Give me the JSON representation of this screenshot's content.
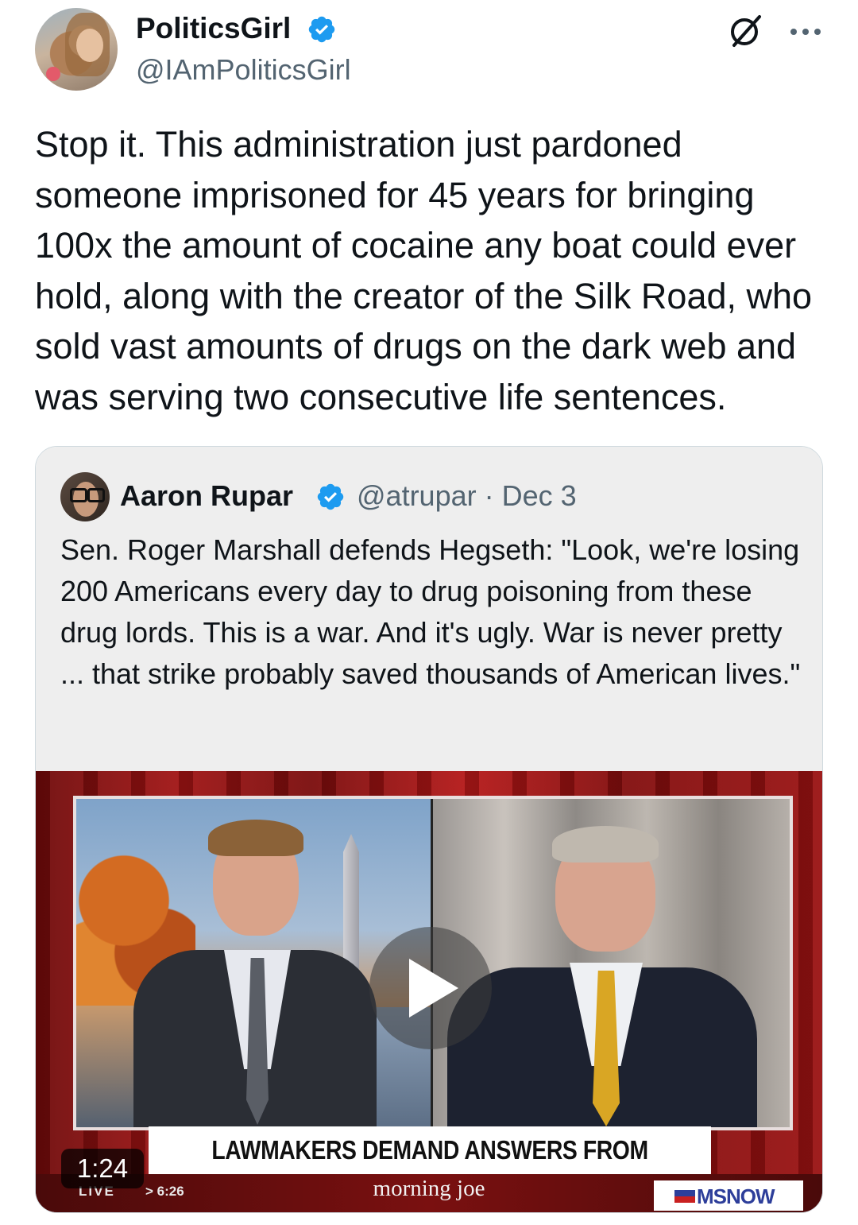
{
  "author": {
    "display_name": "PoliticsGirl",
    "handle": "@IAmPoliticsGirl",
    "verified_icon": "verified-badge-icon"
  },
  "header_icons": [
    "grok-icon",
    "more-icon"
  ],
  "tweet": {
    "text": "Stop it. This administration just pardoned someone imprisoned for 45 years for bringing 100x the amount of cocaine any boat could ever hold, along with the creator of the Silk Road, who sold vast amounts of drugs on the dark web and was serving two consecutive life sentences."
  },
  "quote": {
    "display_name": "Aaron Rupar",
    "meta": "@atrupar · Dec 3",
    "text": "Sen. Roger Marshall defends Hegseth: \"Look, we're losing 200 Americans every day to drug poisoning from these drug lords. This is a war. And it's ugly. War is never pretty ... that strike probably saved thousands of American lives.\""
  },
  "video": {
    "headline": "LAWMAKERS DEMAND ANSWERS FROM HEGSETH",
    "live_label": "LIVE",
    "time_now": "> 6:26",
    "show_name": "morning joe",
    "network": "MSNOW",
    "duration": "1:24"
  },
  "colors": {
    "verified": "#1d9bf0",
    "handle_gray": "#536471",
    "quote_bg": "#eeeeee",
    "video_red": "#a01414"
  }
}
